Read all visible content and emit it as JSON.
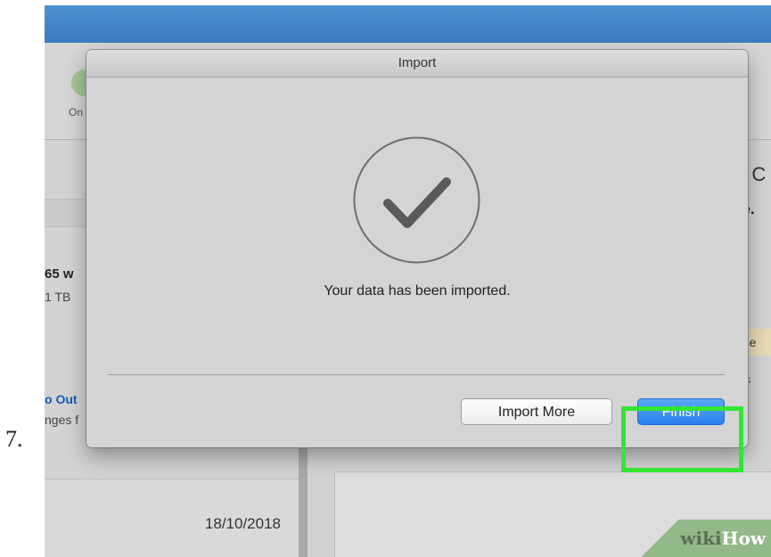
{
  "step": {
    "number": "7."
  },
  "background": {
    "toolbar_label": "On",
    "left_panel": {
      "line1": "65 w",
      "line2": "1 TB",
      "link": "o Out",
      "link_sub": "nges f",
      "date": "18/10/2018"
    },
    "right_panel": {
      "title": "n C",
      "heading": "ce.",
      "badge": "age",
      "small": "of s"
    },
    "watermark": {
      "wiki": "wiki",
      "how": "How"
    }
  },
  "dialog": {
    "title": "Import",
    "icon": "checkmark-icon",
    "message": "Your data has been imported.",
    "buttons": {
      "import_more": "Import More",
      "finish": "Finish"
    }
  },
  "colors": {
    "primary_button": "#2a7ff0",
    "highlight": "#32e632",
    "titlebar_blue": "#3a7dc0"
  }
}
